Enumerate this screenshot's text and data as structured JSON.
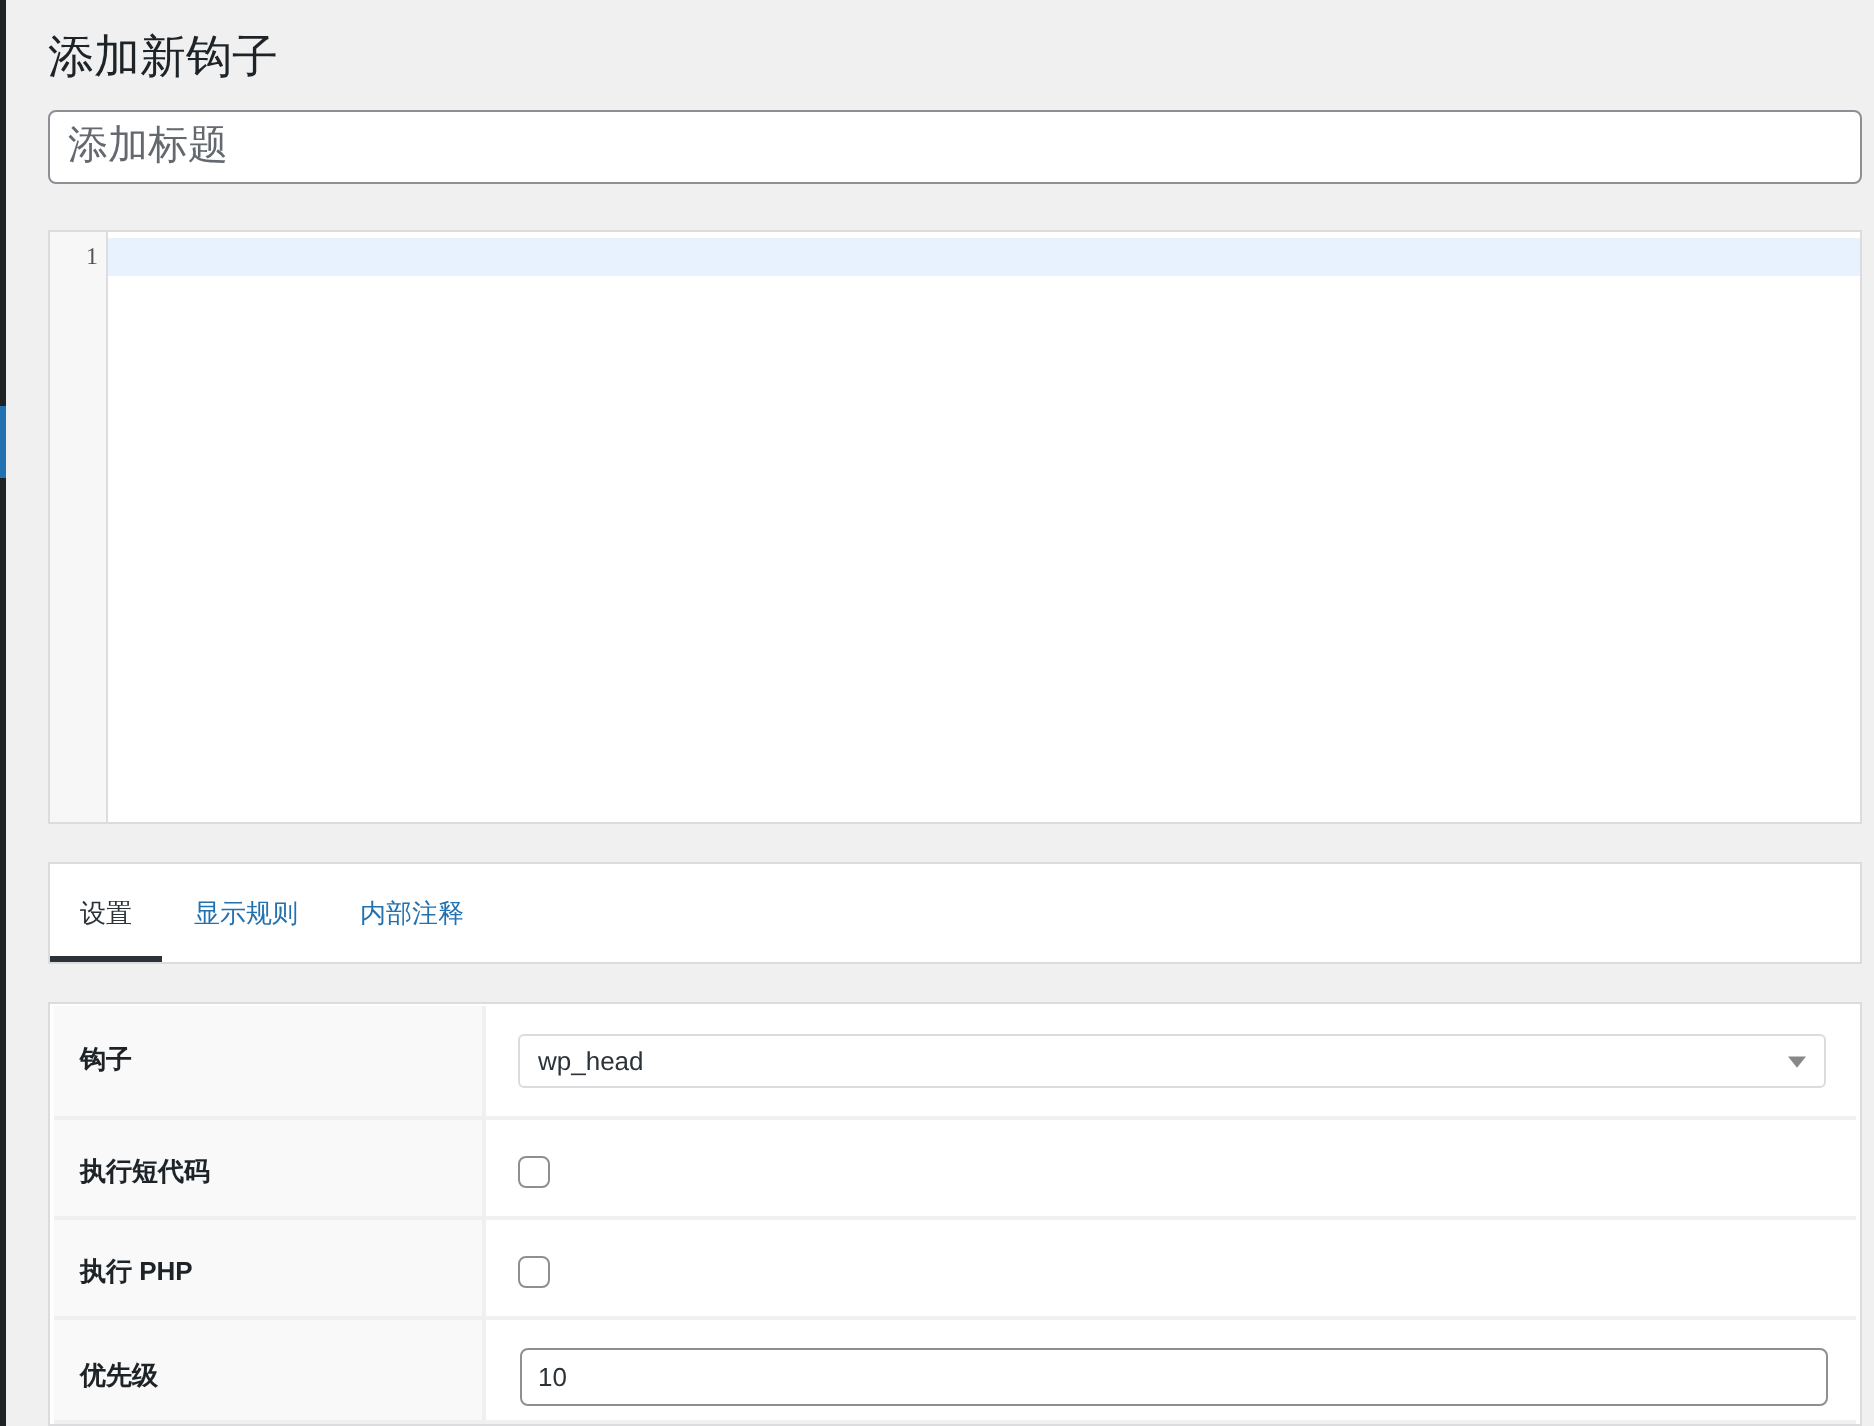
{
  "page": {
    "title": "添加新钩子"
  },
  "title_field": {
    "placeholder": "添加标题"
  },
  "code_editor": {
    "lines": [
      {
        "number": "1",
        "active": true
      }
    ]
  },
  "tabs": [
    {
      "label": "设置",
      "selected": true
    },
    {
      "label": "显示规则",
      "selected": false
    },
    {
      "label": "内部注释",
      "selected": false
    }
  ],
  "settings": [
    {
      "label": "钩子",
      "kind": "select",
      "value": "wp_head"
    },
    {
      "label": "执行短代码",
      "kind": "checkbox",
      "checked": false
    },
    {
      "label": "执行 PHP",
      "kind": "checkbox",
      "checked": false
    },
    {
      "label": "优先级",
      "kind": "input",
      "value": "10"
    }
  ]
}
